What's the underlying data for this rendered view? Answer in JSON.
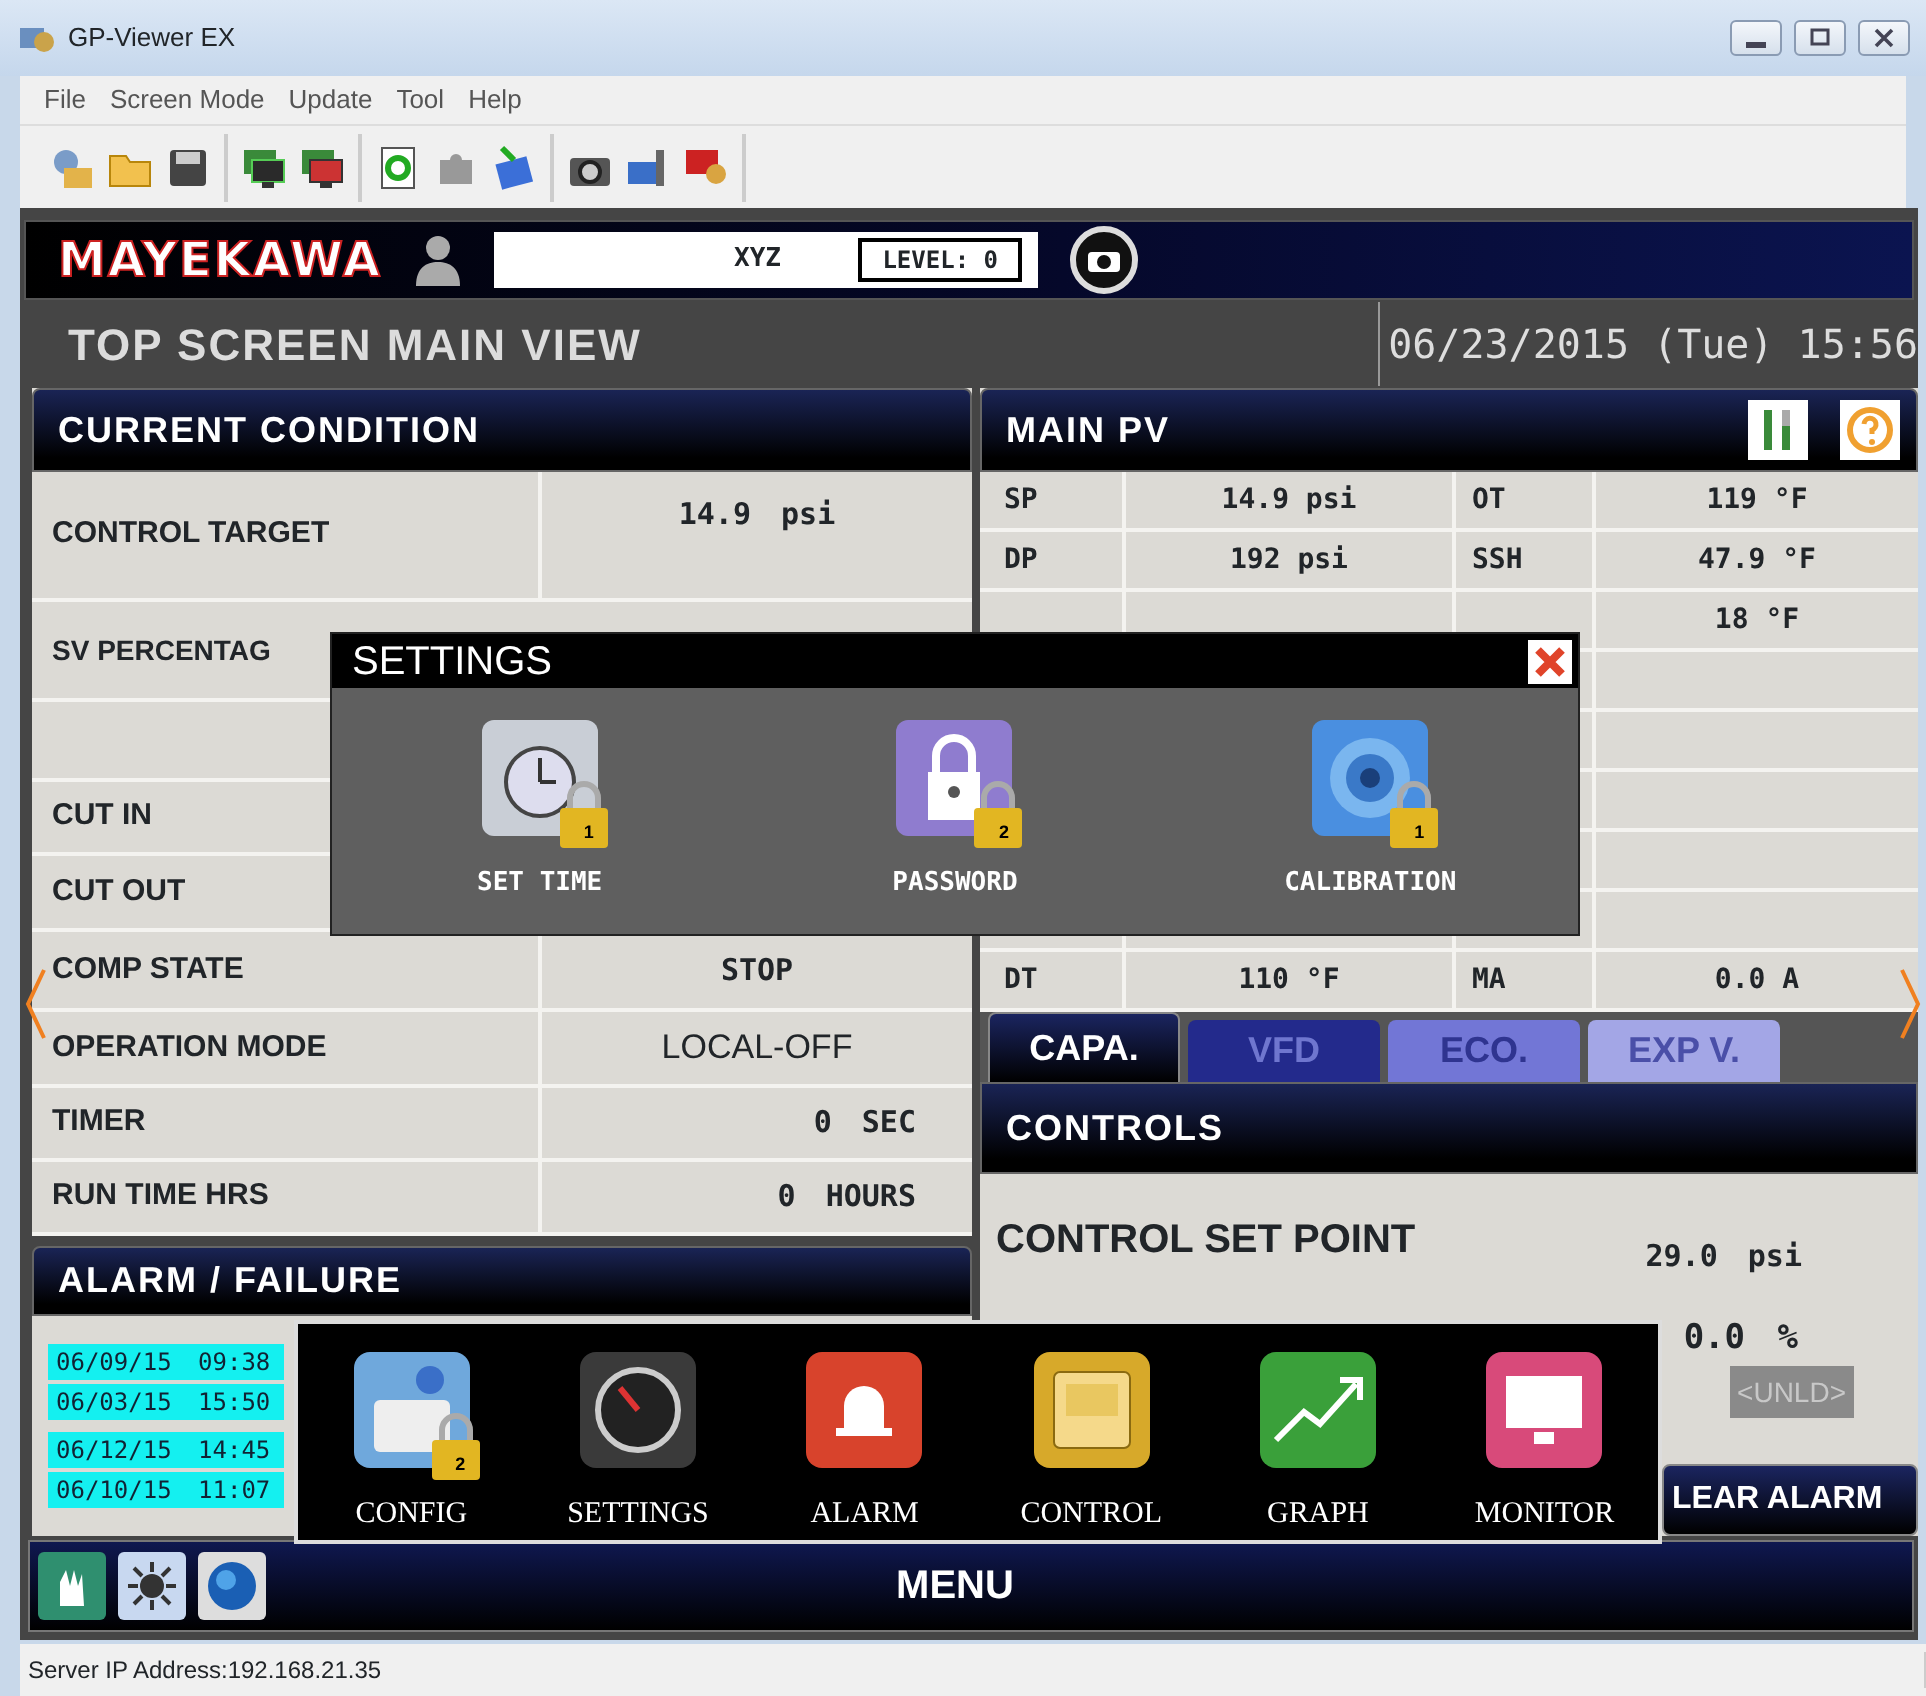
{
  "window": {
    "title": "GP-Viewer EX"
  },
  "menu_bar": [
    "File",
    "Screen Mode",
    "Update",
    "Tool",
    "Help"
  ],
  "header": {
    "logo": "MAYEKAWA",
    "user": "XYZ",
    "level": "LEVEL: 0"
  },
  "screen_title": "TOP SCREEN MAIN VIEW",
  "datetime": "06/23/2015 (Tue) 15:56",
  "current_condition": {
    "title": "CURRENT CONDITION",
    "rows": [
      {
        "label": "CONTROL TARGET",
        "value": "14.9 psi"
      },
      {
        "label": "SV PERCENTAG"
      },
      {},
      {
        "label": "CUT IN"
      },
      {
        "label": "CUT OUT"
      },
      {
        "label": "COMP STATE",
        "value": "STOP"
      },
      {
        "label": "OPERATION MODE",
        "value": "LOCAL-OFF"
      },
      {
        "label": "TIMER",
        "value": "0 SEC"
      },
      {
        "label": "RUN TIME HRS",
        "value": "0 HOURS"
      }
    ]
  },
  "alarm_failure": {
    "title": "ALARM / FAILURE",
    "entries": [
      "06/09/15 09:38",
      "06/03/15 15:50",
      "06/12/15 14:45",
      "06/10/15 11:07"
    ]
  },
  "main_pv": {
    "title": "MAIN PV",
    "rows": [
      {
        "label": "SP",
        "value": "14.9 psi",
        "label_2": "OT",
        "value_2": "119 °F"
      },
      {
        "label": "DP",
        "value": "192 psi",
        "label_2": "SSH",
        "value_2": "47.9 °F"
      },
      {
        "value_2": "18 °F"
      },
      {},
      {},
      {},
      {},
      {},
      {
        "label": "DT",
        "value": "110 °F",
        "label_2": "MA",
        "value_2": "0.0 A"
      }
    ]
  },
  "tabs": [
    {
      "label": "CAPA.",
      "selected": true,
      "disabled": false
    },
    {
      "label": "VFD",
      "selected": false,
      "disabled": false
    },
    {
      "label": "ECO.",
      "selected": false,
      "disabled": true
    },
    {
      "label": "EXP V.",
      "selected": false,
      "disabled": true
    }
  ],
  "controls": {
    "title": "CONTROLS",
    "set_point_label": "CONTROL SET POINT",
    "set_point_value": "29.0 psi",
    "reading": "0.0 %",
    "button": "<UNLD>",
    "clear_alarm": "LEAR ALARM"
  },
  "settings_dialog": {
    "title": "SETTINGS",
    "items": [
      {
        "label": "SET TIME",
        "lock": "1"
      },
      {
        "label": "PASSWORD",
        "lock": "2"
      },
      {
        "label": "CALIBRATION",
        "lock": "1"
      }
    ]
  },
  "menu_popup": {
    "items": [
      {
        "label": "CONFIG",
        "lock": "2"
      },
      {
        "label": "SETTINGS"
      },
      {
        "label": "ALARM"
      },
      {
        "label": "CONTROL"
      },
      {
        "label": "GRAPH"
      },
      {
        "label": "MONITOR"
      }
    ]
  },
  "menu_label": "MENU",
  "status_bar": {
    "server": "Server IP Address:192.168.21.35"
  }
}
